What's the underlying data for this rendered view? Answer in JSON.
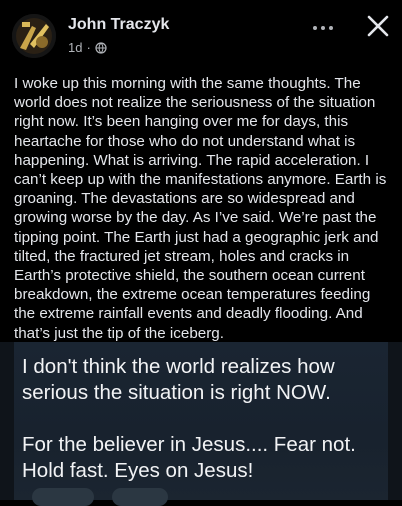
{
  "post": {
    "author": "John Traczyk",
    "time": "1d",
    "privacy_icon": "globe-icon",
    "body": "I woke up this morning with the same thoughts. The world does not realize the seriousness of the situation right now. It’s been hanging over me for days, this heartache for those who do not understand what is happening. What is arriving. The rapid acceleration. I can’t keep up with the manifestations anymore. Earth is groaning. The devastations are so widespread and growing worse by the day. As I’ve said. We’re past the tipping point. The Earth just had a geographic jerk and tilted, the fractured jet stream, holes and cracks in Earth’s protective shield, the southern ocean current breakdown, the extreme ocean temperatures feeding the extreme rainfall events and deadly flooding. And that’s just the tip of the iceberg."
  },
  "image": {
    "text": "I don't think the world realizes how serious the situation is right NOW.\n\nFor the believer in Jesus.... Fear not. Hold fast. Eyes on Jesus!"
  },
  "icons": {
    "more": "more-horizontal-icon",
    "close": "close-icon"
  },
  "colors": {
    "background": "#000000",
    "text": "#e4e6eb",
    "secondary_text": "#b0b3b8",
    "image_background": "#1a2532"
  }
}
